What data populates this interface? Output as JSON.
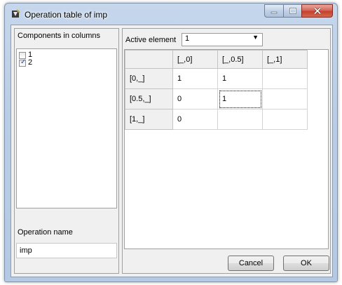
{
  "window": {
    "title": "Operation table of imp"
  },
  "components": {
    "header": "Components in columns",
    "items": [
      {
        "label": "1",
        "checked": false
      },
      {
        "label": "2",
        "checked": true
      }
    ]
  },
  "operation": {
    "label": "Operation name",
    "value": "imp"
  },
  "active_element": {
    "label": "Active element",
    "value": "1"
  },
  "grid": {
    "columns": [
      "[_,0]",
      "[_,0.5]",
      "[_,1]"
    ],
    "rows": [
      {
        "header": "[0,_]",
        "cells": [
          "1",
          "1",
          ""
        ]
      },
      {
        "header": "[0.5,_]",
        "cells": [
          "0",
          "1",
          ""
        ]
      },
      {
        "header": "[1,_]",
        "cells": [
          "0",
          "",
          ""
        ]
      }
    ]
  },
  "buttons": {
    "cancel": "Cancel",
    "ok": "OK"
  },
  "icons": {
    "app": "app-icon",
    "minimize": "minimize-icon",
    "maximize": "maximize-icon",
    "close": "close-icon",
    "dropdown": "chevron-down-icon",
    "check": "check-icon"
  }
}
